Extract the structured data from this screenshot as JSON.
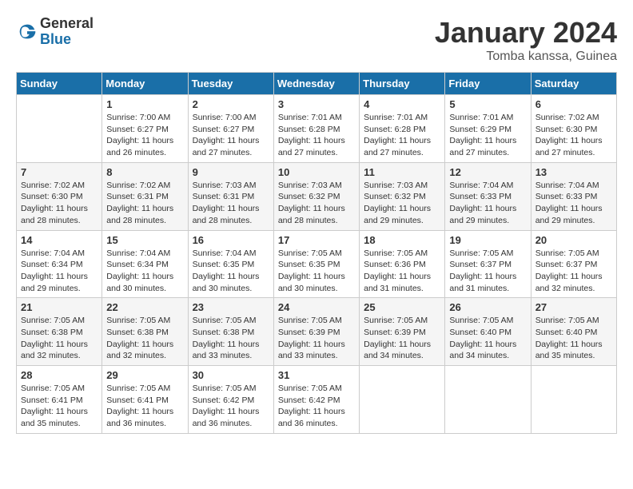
{
  "logo": {
    "general": "General",
    "blue": "Blue"
  },
  "title": "January 2024",
  "location": "Tomba kanssa, Guinea",
  "days_header": [
    "Sunday",
    "Monday",
    "Tuesday",
    "Wednesday",
    "Thursday",
    "Friday",
    "Saturday"
  ],
  "weeks": [
    [
      {
        "day": "",
        "sunrise": "",
        "sunset": "",
        "daylight": ""
      },
      {
        "day": "1",
        "sunrise": "Sunrise: 7:00 AM",
        "sunset": "Sunset: 6:27 PM",
        "daylight": "Daylight: 11 hours and 26 minutes."
      },
      {
        "day": "2",
        "sunrise": "Sunrise: 7:00 AM",
        "sunset": "Sunset: 6:27 PM",
        "daylight": "Daylight: 11 hours and 27 minutes."
      },
      {
        "day": "3",
        "sunrise": "Sunrise: 7:01 AM",
        "sunset": "Sunset: 6:28 PM",
        "daylight": "Daylight: 11 hours and 27 minutes."
      },
      {
        "day": "4",
        "sunrise": "Sunrise: 7:01 AM",
        "sunset": "Sunset: 6:28 PM",
        "daylight": "Daylight: 11 hours and 27 minutes."
      },
      {
        "day": "5",
        "sunrise": "Sunrise: 7:01 AM",
        "sunset": "Sunset: 6:29 PM",
        "daylight": "Daylight: 11 hours and 27 minutes."
      },
      {
        "day": "6",
        "sunrise": "Sunrise: 7:02 AM",
        "sunset": "Sunset: 6:30 PM",
        "daylight": "Daylight: 11 hours and 27 minutes."
      }
    ],
    [
      {
        "day": "7",
        "sunrise": "Sunrise: 7:02 AM",
        "sunset": "Sunset: 6:30 PM",
        "daylight": "Daylight: 11 hours and 28 minutes."
      },
      {
        "day": "8",
        "sunrise": "Sunrise: 7:02 AM",
        "sunset": "Sunset: 6:31 PM",
        "daylight": "Daylight: 11 hours and 28 minutes."
      },
      {
        "day": "9",
        "sunrise": "Sunrise: 7:03 AM",
        "sunset": "Sunset: 6:31 PM",
        "daylight": "Daylight: 11 hours and 28 minutes."
      },
      {
        "day": "10",
        "sunrise": "Sunrise: 7:03 AM",
        "sunset": "Sunset: 6:32 PM",
        "daylight": "Daylight: 11 hours and 28 minutes."
      },
      {
        "day": "11",
        "sunrise": "Sunrise: 7:03 AM",
        "sunset": "Sunset: 6:32 PM",
        "daylight": "Daylight: 11 hours and 29 minutes."
      },
      {
        "day": "12",
        "sunrise": "Sunrise: 7:04 AM",
        "sunset": "Sunset: 6:33 PM",
        "daylight": "Daylight: 11 hours and 29 minutes."
      },
      {
        "day": "13",
        "sunrise": "Sunrise: 7:04 AM",
        "sunset": "Sunset: 6:33 PM",
        "daylight": "Daylight: 11 hours and 29 minutes."
      }
    ],
    [
      {
        "day": "14",
        "sunrise": "Sunrise: 7:04 AM",
        "sunset": "Sunset: 6:34 PM",
        "daylight": "Daylight: 11 hours and 29 minutes."
      },
      {
        "day": "15",
        "sunrise": "Sunrise: 7:04 AM",
        "sunset": "Sunset: 6:34 PM",
        "daylight": "Daylight: 11 hours and 30 minutes."
      },
      {
        "day": "16",
        "sunrise": "Sunrise: 7:04 AM",
        "sunset": "Sunset: 6:35 PM",
        "daylight": "Daylight: 11 hours and 30 minutes."
      },
      {
        "day": "17",
        "sunrise": "Sunrise: 7:05 AM",
        "sunset": "Sunset: 6:35 PM",
        "daylight": "Daylight: 11 hours and 30 minutes."
      },
      {
        "day": "18",
        "sunrise": "Sunrise: 7:05 AM",
        "sunset": "Sunset: 6:36 PM",
        "daylight": "Daylight: 11 hours and 31 minutes."
      },
      {
        "day": "19",
        "sunrise": "Sunrise: 7:05 AM",
        "sunset": "Sunset: 6:37 PM",
        "daylight": "Daylight: 11 hours and 31 minutes."
      },
      {
        "day": "20",
        "sunrise": "Sunrise: 7:05 AM",
        "sunset": "Sunset: 6:37 PM",
        "daylight": "Daylight: 11 hours and 32 minutes."
      }
    ],
    [
      {
        "day": "21",
        "sunrise": "Sunrise: 7:05 AM",
        "sunset": "Sunset: 6:38 PM",
        "daylight": "Daylight: 11 hours and 32 minutes."
      },
      {
        "day": "22",
        "sunrise": "Sunrise: 7:05 AM",
        "sunset": "Sunset: 6:38 PM",
        "daylight": "Daylight: 11 hours and 32 minutes."
      },
      {
        "day": "23",
        "sunrise": "Sunrise: 7:05 AM",
        "sunset": "Sunset: 6:38 PM",
        "daylight": "Daylight: 11 hours and 33 minutes."
      },
      {
        "day": "24",
        "sunrise": "Sunrise: 7:05 AM",
        "sunset": "Sunset: 6:39 PM",
        "daylight": "Daylight: 11 hours and 33 minutes."
      },
      {
        "day": "25",
        "sunrise": "Sunrise: 7:05 AM",
        "sunset": "Sunset: 6:39 PM",
        "daylight": "Daylight: 11 hours and 34 minutes."
      },
      {
        "day": "26",
        "sunrise": "Sunrise: 7:05 AM",
        "sunset": "Sunset: 6:40 PM",
        "daylight": "Daylight: 11 hours and 34 minutes."
      },
      {
        "day": "27",
        "sunrise": "Sunrise: 7:05 AM",
        "sunset": "Sunset: 6:40 PM",
        "daylight": "Daylight: 11 hours and 35 minutes."
      }
    ],
    [
      {
        "day": "28",
        "sunrise": "Sunrise: 7:05 AM",
        "sunset": "Sunset: 6:41 PM",
        "daylight": "Daylight: 11 hours and 35 minutes."
      },
      {
        "day": "29",
        "sunrise": "Sunrise: 7:05 AM",
        "sunset": "Sunset: 6:41 PM",
        "daylight": "Daylight: 11 hours and 36 minutes."
      },
      {
        "day": "30",
        "sunrise": "Sunrise: 7:05 AM",
        "sunset": "Sunset: 6:42 PM",
        "daylight": "Daylight: 11 hours and 36 minutes."
      },
      {
        "day": "31",
        "sunrise": "Sunrise: 7:05 AM",
        "sunset": "Sunset: 6:42 PM",
        "daylight": "Daylight: 11 hours and 36 minutes."
      },
      {
        "day": "",
        "sunrise": "",
        "sunset": "",
        "daylight": ""
      },
      {
        "day": "",
        "sunrise": "",
        "sunset": "",
        "daylight": ""
      },
      {
        "day": "",
        "sunrise": "",
        "sunset": "",
        "daylight": ""
      }
    ]
  ]
}
